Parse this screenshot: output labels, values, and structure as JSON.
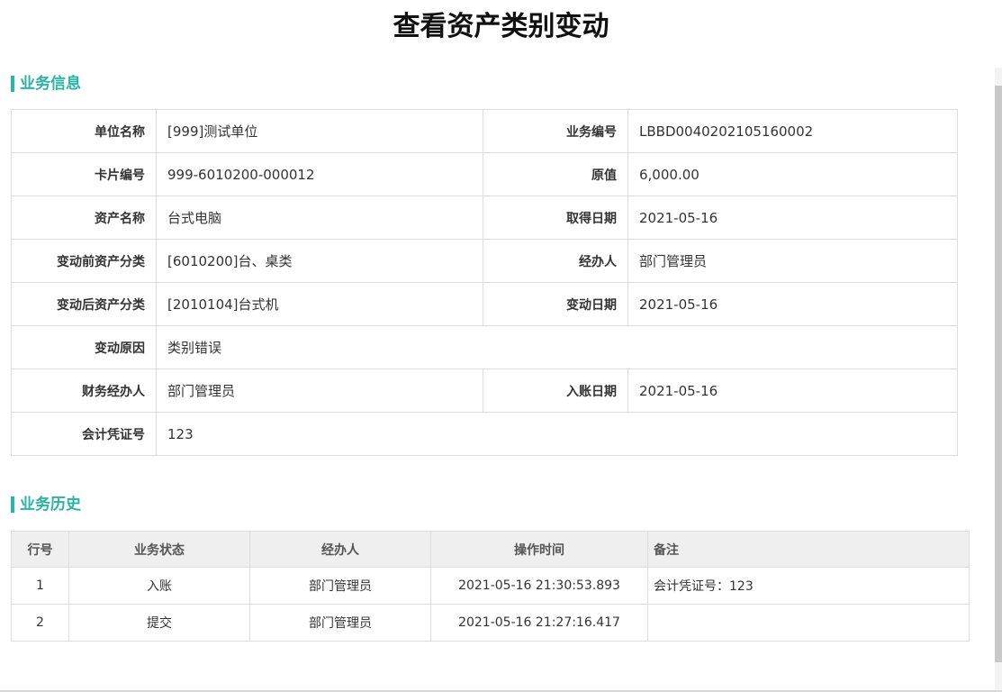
{
  "page_title": "查看资产类别变动",
  "sections": {
    "info_title": "业务信息",
    "history_title": "业务历史"
  },
  "info": {
    "unit_label": "单位名称",
    "unit_value": "[999]测试单位",
    "bizno_label": "业务编号",
    "bizno_value": "LBBD0040202105160002",
    "card_label": "卡片编号",
    "card_value": "999-6010200-000012",
    "orig_label": "原值",
    "orig_value": "6,000.00",
    "asset_label": "资产名称",
    "asset_value": "台式电脑",
    "acq_label": "取得日期",
    "acq_value": "2021-05-16",
    "before_label": "变动前资产分类",
    "before_value": "[6010200]台、桌类",
    "handler_label": "经办人",
    "handler_value": "部门管理员",
    "after_label": "变动后资产分类",
    "after_value": "[2010104]台式机",
    "change_date_label": "变动日期",
    "change_date_value": "2021-05-16",
    "reason_label": "变动原因",
    "reason_value": "类别错误",
    "fin_handler_label": "财务经办人",
    "fin_handler_value": "部门管理员",
    "entry_date_label": "入账日期",
    "entry_date_value": "2021-05-16",
    "voucher_label": "会计凭证号",
    "voucher_value": "123"
  },
  "history": {
    "headers": [
      "行号",
      "业务状态",
      "经办人",
      "操作时间",
      "备注"
    ],
    "rows": [
      [
        "1",
        "入账",
        "部门管理员",
        "2021-05-16 21:30:53.893",
        "会计凭证号：123"
      ],
      [
        "2",
        "提交",
        "部门管理员",
        "2021-05-16 21:27:16.417",
        ""
      ]
    ]
  }
}
